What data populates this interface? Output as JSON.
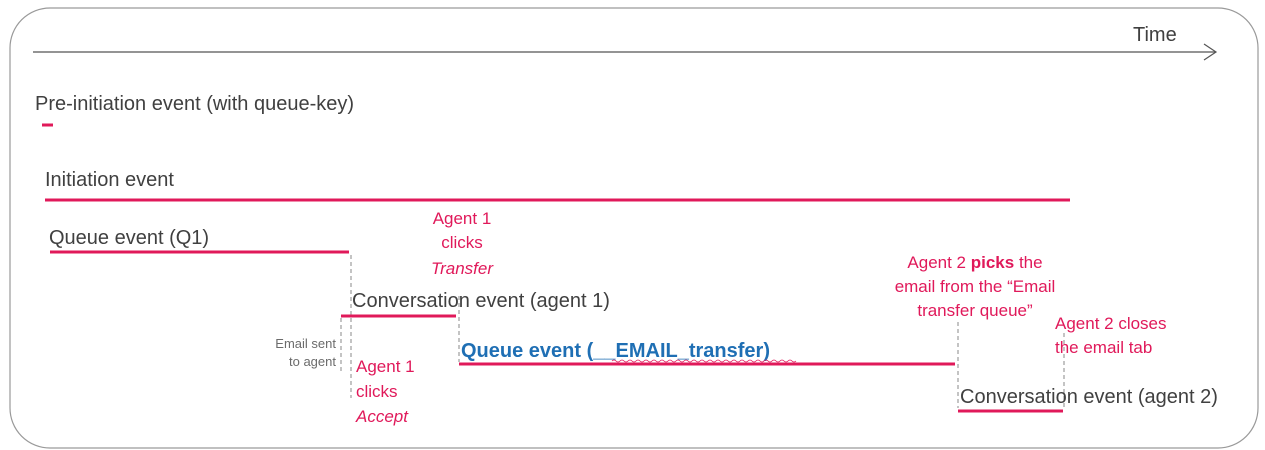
{
  "diagram": {
    "time_label": "Time",
    "events": {
      "pre_initiation": "Pre-initiation event (with queue-key)",
      "initiation": "Initiation event",
      "queue_q1": "Queue event (Q1)",
      "conversation_agent1": "Conversation event (agent 1)",
      "queue_email_transfer": "Queue event (__EMAIL_transfer)",
      "conversation_agent2": "Conversation event (agent 2)"
    },
    "annotations": {
      "email_sent": [
        "Email sent",
        "to agent"
      ],
      "agent1_accept": [
        "Agent 1",
        "clicks",
        "Accept"
      ],
      "agent1_transfer": [
        "Agent 1",
        "clicks",
        "Transfer"
      ],
      "agent2_picks": {
        "line1_pre": "Agent 2 ",
        "line1_bold": "picks",
        "line1_post": " the",
        "line2": "email from the “Email",
        "line3": "transfer queue”"
      },
      "agent2_closes": [
        "Agent 2 closes",
        "the email tab"
      ]
    },
    "colors": {
      "bar": "#e0195a",
      "annotation": "#e0195a",
      "queue_transfer_text": "#1f6fb4",
      "event_text": "#404040",
      "axis": "#555555"
    }
  }
}
